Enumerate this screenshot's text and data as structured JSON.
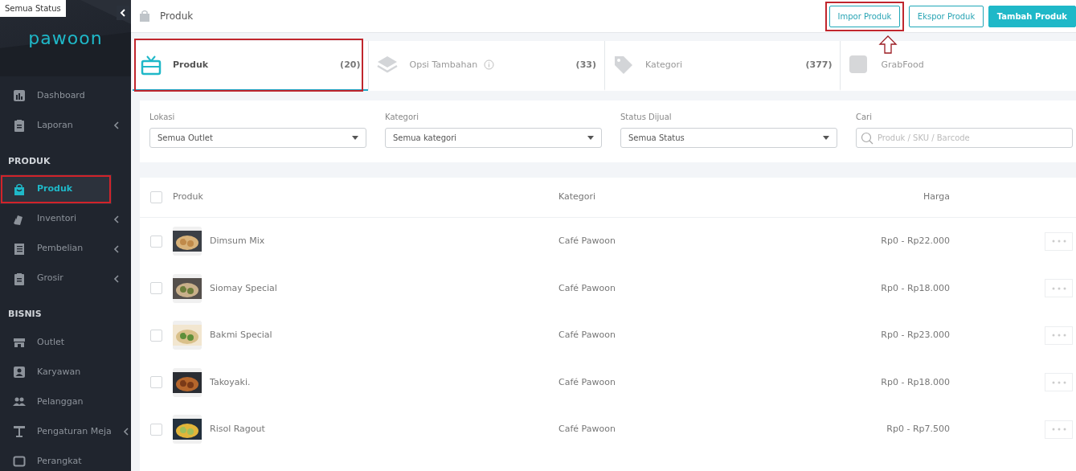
{
  "tooltip": {
    "text": "Semua Status"
  },
  "sidebar": {
    "logo": "pawoon",
    "sections": [
      {
        "items": [
          {
            "label": "Dashboard",
            "submenu": false,
            "selected": false,
            "highlighted": false
          },
          {
            "label": "Laporan",
            "submenu": true,
            "selected": false,
            "highlighted": false
          }
        ]
      },
      {
        "heading": "PRODUK",
        "items": [
          {
            "label": "Produk",
            "submenu": false,
            "selected": true,
            "highlighted": true
          },
          {
            "label": "Inventori",
            "submenu": true,
            "selected": false,
            "highlighted": false
          },
          {
            "label": "Pembelian",
            "submenu": true,
            "selected": false,
            "highlighted": false
          },
          {
            "label": "Grosir",
            "submenu": true,
            "selected": false,
            "highlighted": false
          }
        ]
      },
      {
        "heading": "BISNIS",
        "items": [
          {
            "label": "Outlet",
            "submenu": false,
            "selected": false,
            "highlighted": false
          },
          {
            "label": "Karyawan",
            "submenu": false,
            "selected": false,
            "highlighted": false
          },
          {
            "label": "Pelanggan",
            "submenu": false,
            "selected": false,
            "highlighted": false
          },
          {
            "label": "Pengaturan Meja",
            "submenu": true,
            "selected": false,
            "highlighted": false
          },
          {
            "label": "Perangkat",
            "submenu": false,
            "selected": false,
            "highlighted": false
          }
        ]
      }
    ]
  },
  "header": {
    "title": "Produk",
    "buttons": [
      {
        "label": "Impor Produk",
        "kind": "outline",
        "highlighted": true
      },
      {
        "label": "Ekspor Produk",
        "kind": "outline",
        "highlighted": false
      },
      {
        "label": "Tambah Produk",
        "kind": "solid",
        "highlighted": false
      }
    ]
  },
  "tabs": [
    {
      "label": "Produk",
      "count": "(20)",
      "info": false,
      "selected": true,
      "highlighted": true
    },
    {
      "label": "Opsi Tambahan",
      "count": "(33)",
      "info": true,
      "selected": false,
      "highlighted": false
    },
    {
      "label": "Kategori",
      "count": "(377)",
      "info": false,
      "selected": false,
      "highlighted": false
    },
    {
      "label": "GrabFood",
      "info": false,
      "selected": false,
      "highlighted": false
    }
  ],
  "filters": [
    {
      "kind": "select",
      "label": "Lokasi",
      "value": "Semua Outlet"
    },
    {
      "kind": "select",
      "label": "Kategori",
      "value": "Semua kategori"
    },
    {
      "kind": "select",
      "label": "Status Dijual",
      "value": "Semua Status"
    },
    {
      "kind": "search",
      "label": "Cari",
      "placeholder": "Produk / SKU / Barcode"
    }
  ],
  "table": {
    "columns": [
      "Produk",
      "Kategori",
      "Harga"
    ],
    "all_checked": false,
    "rows": [
      {
        "name": "Dimsum Mix",
        "category": "Café Pawoon",
        "price": "Rp0 - Rp22.000",
        "checked": false
      },
      {
        "name": "Siomay Special",
        "category": "Café Pawoon",
        "price": "Rp0 - Rp18.000",
        "checked": false
      },
      {
        "name": "Bakmi Special",
        "category": "Café Pawoon",
        "price": "Rp0 - Rp23.000",
        "checked": false
      },
      {
        "name": "Takoyaki.",
        "category": "Café Pawoon",
        "price": "Rp0 - Rp18.000",
        "checked": false
      },
      {
        "name": "Risol Ragout",
        "category": "Café Pawoon",
        "price": "Rp0 - Rp7.500",
        "checked": false
      }
    ]
  }
}
